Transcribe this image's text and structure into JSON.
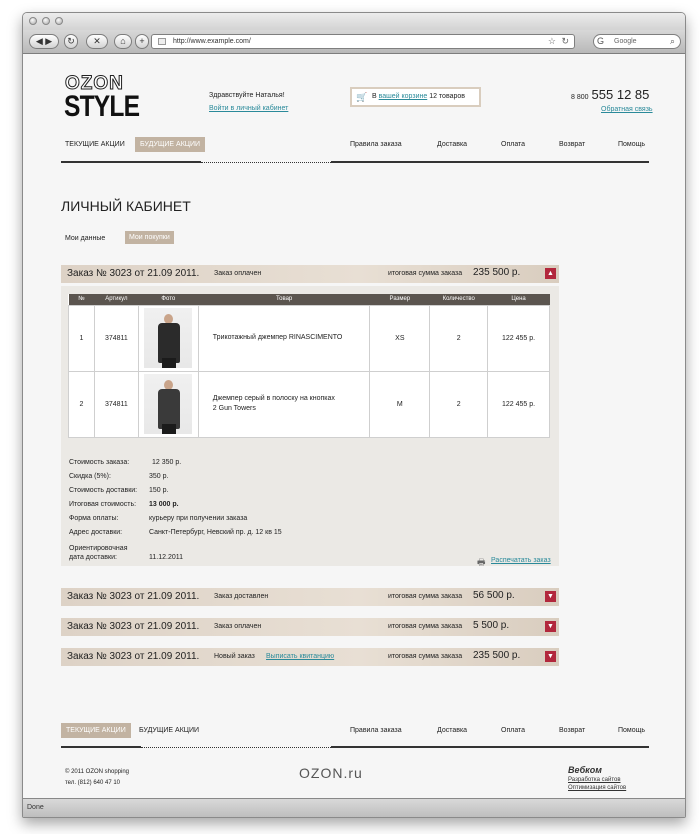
{
  "browser": {
    "url": "http://www.example.com/",
    "search_placeholder": "Google",
    "status": "Done"
  },
  "logo": {
    "top": "OZON",
    "bottom": "STYLE"
  },
  "header": {
    "greeting": "Здравствуйте Наталья!",
    "account_link": "Войти в личный кабинет",
    "cart_prefix": "В",
    "cart_link": "вашей корзине",
    "cart_count": "12 товаров",
    "phone_prefix": "8 800",
    "phone_main": "555 12 85",
    "feedback_link": "Обратная связь"
  },
  "nav": {
    "current_promos": "ТЕКУЩИЕ АКЦИИ",
    "future_promos": "БУДУЩИЕ АКЦИИ",
    "order_rules": "Правила заказа",
    "delivery": "Доставка",
    "payment": "Оплата",
    "returns": "Возврат",
    "help": "Помощь"
  },
  "page": {
    "title": "ЛИЧНЫЙ КАБИНЕТ",
    "tab_my_data": "Мои данные",
    "tab_my_purchases": "Мои покупки"
  },
  "orders": [
    {
      "number": "Заказ № 3023 от 21.09 2011.",
      "status": "Заказ оплачен",
      "total_label": "итоговая сумма  заказа",
      "amount": "235 500 р."
    },
    {
      "number": "Заказ № 3023 от 21.09 2011.",
      "status": "Заказ доставлен",
      "total_label": "итоговая сумма  заказа",
      "amount": "56 500 р."
    },
    {
      "number": "Заказ № 3023 от 21.09 2011.",
      "status": "Заказ оплачен",
      "total_label": "итоговая сумма  заказа",
      "amount": "5 500 р."
    },
    {
      "number": "Заказ № 3023 от 21.09 2011.",
      "status": "Новый заказ",
      "receipt_link": "Выписать квитанцию",
      "total_label": "итоговая сумма  заказа",
      "amount": "235 500 р."
    }
  ],
  "table": {
    "headers": [
      "№",
      "Артикул",
      "Фото",
      "Товар",
      "Размер",
      "Количество",
      "Цена"
    ],
    "rows": [
      {
        "n": "1",
        "sku": "374811",
        "name1": "Трикотажный джемпер RINASCIMENTO",
        "name2": "",
        "size": "XS",
        "qty": "2",
        "price": "122 455 р."
      },
      {
        "n": "2",
        "sku": "374811",
        "name1": "Джемпер серый в полоску на кнопках",
        "name2": "2 Gun Towers",
        "size": "M",
        "qty": "2",
        "price": "122 455 р."
      }
    ]
  },
  "summary": {
    "cost_label": "Стоимость заказа:",
    "cost": "12 350 р.",
    "discount_label": "Скидка (5%):",
    "discount": "350 р.",
    "delivery_label": "Стоимость доставки:",
    "delivery": "150 р.",
    "total_label": "Итоговая стоимость:",
    "total": "13 000 р.",
    "payment_label": "Форма оплаты:",
    "payment": "курьеру при получении заказа",
    "address_label": "Адрес доставки:",
    "address": "Санкт-Петербург, Невский пр. д. 12 кв 15",
    "date_label1": "Ориентировочная",
    "date_label2": "дата доставки:",
    "date": "11.12.2011",
    "print_link": "Распечатать заказ"
  },
  "footer": {
    "copyright": "© 2011 OZON shopping",
    "phone": "тел. (812) 640 47 10",
    "brand": "OZON.ru",
    "studio": "Вебком",
    "studio_link1": "Разработка сайтов",
    "studio_link2": "Оптимизация сайтов"
  }
}
